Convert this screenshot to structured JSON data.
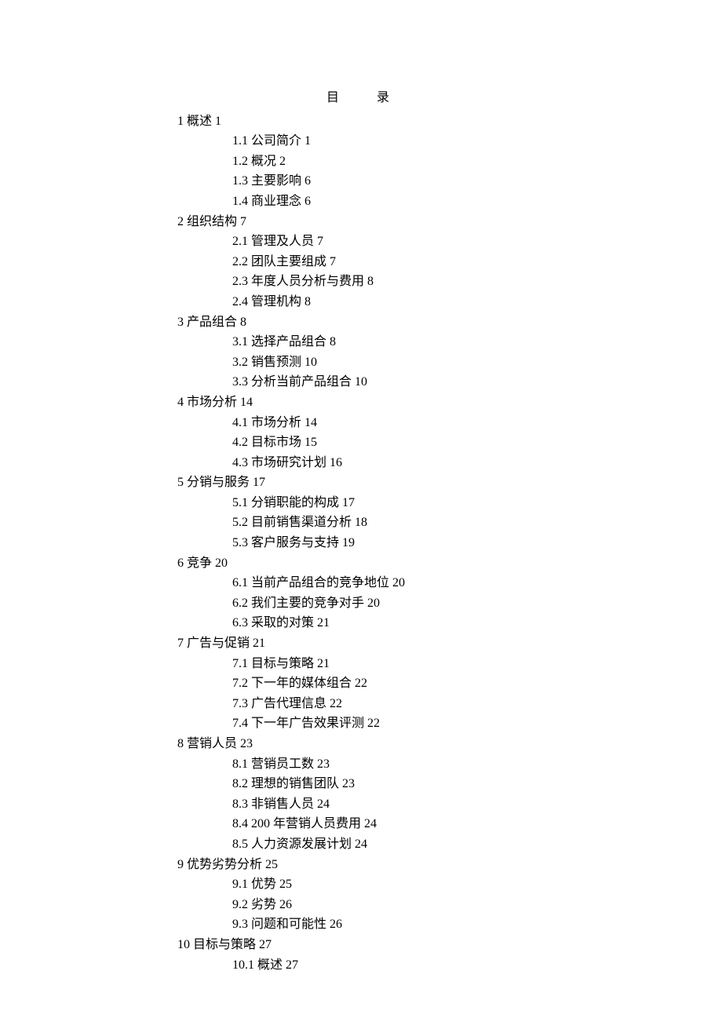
{
  "title": "目录",
  "toc": [
    {
      "level": 1,
      "text": "1  概述 1"
    },
    {
      "level": 2,
      "text": "1.1  公司简介 1"
    },
    {
      "level": 2,
      "text": "1.2  概况 2"
    },
    {
      "level": 2,
      "text": "1.3  主要影响 6"
    },
    {
      "level": 2,
      "text": "1.4  商业理念 6"
    },
    {
      "level": 1,
      "text": "2  组织结构 7"
    },
    {
      "level": 2,
      "text": "2.1  管理及人员 7"
    },
    {
      "level": 2,
      "text": "2.2  团队主要组成 7"
    },
    {
      "level": 2,
      "text": "2.3  年度人员分析与费用 8"
    },
    {
      "level": 2,
      "text": "2.4  管理机构 8"
    },
    {
      "level": 1,
      "text": "3  产品组合 8"
    },
    {
      "level": 2,
      "text": "3.1  选择产品组合 8"
    },
    {
      "level": 2,
      "text": "3.2  销售预测 10"
    },
    {
      "level": 2,
      "text": "3.3  分析当前产品组合 10"
    },
    {
      "level": 1,
      "text": "4  市场分析 14"
    },
    {
      "level": 2,
      "text": "4.1  市场分析 14"
    },
    {
      "level": 2,
      "text": "4.2  目标市场 15"
    },
    {
      "level": 2,
      "text": "4.3  市场研究计划 16"
    },
    {
      "level": 1,
      "text": "5  分销与服务 17"
    },
    {
      "level": 2,
      "text": "5.1  分销职能的构成 17"
    },
    {
      "level": 2,
      "text": "5.2  目前销售渠道分析 18"
    },
    {
      "level": 2,
      "text": "5.3  客户服务与支持 19"
    },
    {
      "level": 1,
      "text": "6  竞争 20"
    },
    {
      "level": 2,
      "text": "6.1  当前产品组合的竞争地位 20"
    },
    {
      "level": 2,
      "text": "6.2  我们主要的竞争对手 20"
    },
    {
      "level": 2,
      "text": "6.3  采取的对策 21"
    },
    {
      "level": 1,
      "text": "7  广告与促销 21"
    },
    {
      "level": 2,
      "text": "7.1  目标与策略 21"
    },
    {
      "level": 2,
      "text": "7.2  下一年的媒体组合 22"
    },
    {
      "level": 2,
      "text": "7.3  广告代理信息 22"
    },
    {
      "level": 2,
      "text": "7.4  下一年广告效果评测 22"
    },
    {
      "level": 1,
      "text": "8  营销人员 23"
    },
    {
      "level": 2,
      "text": "8.1  营销员工数 23"
    },
    {
      "level": 2,
      "text": "8.2  理想的销售团队 23"
    },
    {
      "level": 2,
      "text": "8.3  非销售人员 24"
    },
    {
      "level": 2,
      "text": "8.4 200  年营销人员费用 24"
    },
    {
      "level": 2,
      "text": "8.5  人力资源发展计划 24"
    },
    {
      "level": 1,
      "text": "9  优势劣势分析 25"
    },
    {
      "level": 2,
      "text": "9.1  优势 25"
    },
    {
      "level": 2,
      "text": "9.2  劣势 26"
    },
    {
      "level": 2,
      "text": "9.3  问题和可能性 26"
    },
    {
      "level": 1,
      "text": "10  目标与策略 27"
    },
    {
      "level": 2,
      "text": "10.1  概述 27"
    }
  ]
}
